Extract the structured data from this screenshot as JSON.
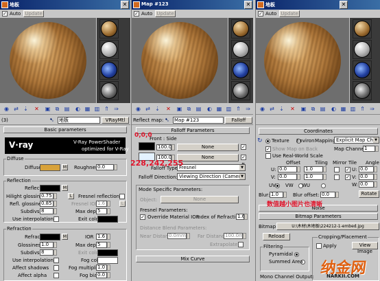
{
  "windows": [
    {
      "title": "地板",
      "auto_label": "Auto",
      "update_label": "Update"
    },
    {
      "title": "Map #123",
      "auto_label": "Auto",
      "update_label": "Update"
    },
    {
      "title": "地板",
      "auto_label": "Auto",
      "update_label": "Update"
    }
  ],
  "win_a": {
    "slot_label": "(3)",
    "material_name": "地板",
    "material_type": "VRayMtl",
    "basic_params_title": "Basic parameters",
    "vray_logo_text": "V·ray",
    "vray_power": "V-Ray PowerShader",
    "vray_optimized": "optimized for V-Ray",
    "diffuse_group": "Diffuse",
    "diffuse_label": "Diffuse",
    "diffuse_color": "#d8a23a",
    "roughness_label": "Roughness",
    "roughness_value": "0.0",
    "m_label": "M",
    "reflection_group": "Reflection",
    "reflect_label": "Reflect",
    "hilight_label": "Hilight glossiness",
    "hilight_value": "0.75",
    "l_label": "L",
    "fresnel_reflections_label": "Fresnel reflections",
    "refl_gloss_label": "Refl. glossiness",
    "refl_gloss_value": "0.85",
    "fresnel_ior_label": "Fresnel IOR",
    "fresnel_ior_value": "1.6",
    "subdivs_label": "Subdivs",
    "subdivs_value": "8",
    "max_depth_label": "Max depth",
    "max_depth_value": "5",
    "use_interp_label": "Use interpolation",
    "exit_color_label": "Exit color",
    "refraction_group": "Refraction",
    "refract_label": "Refract",
    "ior_label": "IOR",
    "ior_value": "1.6",
    "glossiness_label": "Glossiness",
    "glossiness_value": "1.0",
    "r_max_depth_label": "Max depth",
    "r_max_depth_value": "5",
    "r_subdivs_label": "Subdivs",
    "r_subdivs_value": "8",
    "r_exit_color_label": "Exit color",
    "r_use_interp_label": "Use interpolation",
    "fog_color_label": "Fog color",
    "affect_shadows_label": "Affect shadows",
    "fog_mult_label": "Fog multiplier",
    "fog_mult_value": "1.0",
    "affect_alpha_label": "Affect alpha",
    "fog_bias_label": "Fog bias",
    "fog_bias_value": "0.0"
  },
  "win_b": {
    "reflect_map_label": "Reflect map:",
    "map_name": "Map #123",
    "map_type": "Falloff",
    "falloff_params_title": "Falloff Parameters",
    "front_side_label": "Front : Side",
    "val1": "100.0",
    "val2": "100.0",
    "none1": "None",
    "none2": "None",
    "falloff_type_label": "Falloff Type:",
    "falloff_type_value": "Fresnel",
    "falloff_dir_label": "Falloff Direction:",
    "falloff_dir_value": "Viewing Direction (Camera Z-Axis)",
    "mode_specific_title": "Mode Specific Parameters:",
    "object_label": "Object:",
    "object_value": "None",
    "fresnel_params_label": "Fresnel Parameters:",
    "override_ior_label": "Override Material IOR",
    "index_refr_label": "Index of Refraction",
    "index_refr_value": "1.6",
    "dist_blend_label": "Distance Blend Parameters:",
    "near_dist_label": "Near Distance:",
    "near_dist_value": "0.0mm",
    "far_dist_label": "Far Distance:",
    "far_dist_value": "100.0mm",
    "extrapolate_label": "Extrapolate",
    "mix_curve_title": "Mix Curve",
    "annotation_rgb0": "0,0,0",
    "annotation_rgb228": "228,242,255"
  },
  "win_c": {
    "coordinates_title": "Coordinates",
    "texture_label": "Texture",
    "environ_label": "Environ",
    "mapping_label": "Mapping:",
    "mapping_value": "Explicit Map Channel",
    "show_map_label": "Show Map on Back",
    "map_channel_label": "Map Channel:",
    "map_channel_value": "1",
    "use_real_world_label": "Use Real-World Scale",
    "offset_label": "Offset",
    "tiling_label": "Tiling",
    "mirror_tile_label": "Mirror Tile",
    "angle_label": "Angle",
    "u_label": "U:",
    "v_label": "V:",
    "w_label": "W:",
    "u_offset": "0.0",
    "v_offset": "0.0",
    "u_tiling": "1.0",
    "v_tiling": "1.0",
    "u_angle": "0.0",
    "v_angle": "0.0",
    "w_angle": "0.0",
    "uv_label": "UV",
    "vw_label": "VW",
    "wu_label": "WU",
    "blur_label": "Blur:",
    "blur_value": "1.0",
    "blur_offset_label": "Blur offset:",
    "blur_offset_value": "0.0",
    "rotate_label": "Rotate",
    "noise_title": "Noise",
    "bitmap_params_title": "Bitmap Parameters",
    "bitmap_label": "Bitmap:",
    "bitmap_path": "U:\\木材\\木地板\\224212-1-embed.jpg",
    "reload_label": "Reload",
    "cropping_label": "Cropping/Placement",
    "apply_label": "Apply",
    "view_image_label": "View Image",
    "filtering_label": "Filtering",
    "pyramidal_label": "Pyramidal",
    "summed_label": "Summed Area",
    "mono_label": "Mono Channel Output:",
    "annotation_blur": "数值越小图片也清晰",
    "watermark_cn": "纳金网",
    "watermark_url": "NARKII.COM"
  },
  "colors": {
    "title_start": "#0a246a",
    "title_end": "#3a6ea5",
    "annotation_red": "#e0142b",
    "panel_gray": "#c7c7c7"
  }
}
